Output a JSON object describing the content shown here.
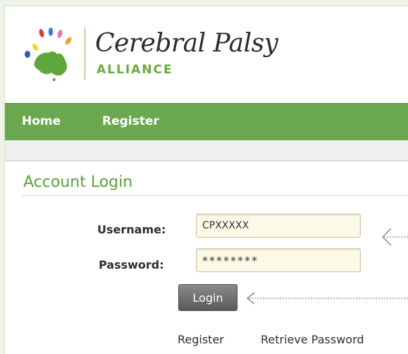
{
  "brand": {
    "name": "Cerebral Palsy",
    "subtitle": "ALLIANCE",
    "green": "#6aa84f",
    "logo_icon": "australia-map-with-colored-drops-icon"
  },
  "nav": {
    "items": [
      {
        "label": "Home"
      },
      {
        "label": "Register"
      }
    ]
  },
  "login": {
    "title": "Account Login",
    "username_label": "Username:",
    "username_value": "CPXXXXX",
    "password_label": "Password:",
    "password_value": "********",
    "button_label": "Login"
  },
  "footer_links": {
    "register": "Register",
    "retrieve": "Retrieve Password"
  },
  "annotations": {
    "arrow_icon": "dotted-arrow-left-icon"
  }
}
